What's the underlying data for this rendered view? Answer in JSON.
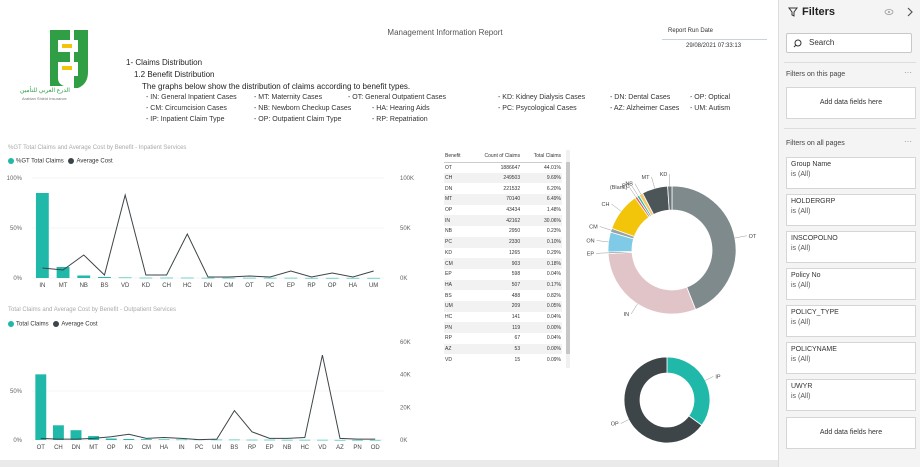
{
  "report": {
    "title": "Management Information Report",
    "run_date_label": "Report Run Date",
    "run_date_value": "29/08/2021 07:33:13",
    "logo_text_ar": "الدرع العربي للتأمين",
    "logo_text_en": "Arabian Shield Insurance"
  },
  "intro": {
    "section": "1- Claims Distribution",
    "subsection": "1.2 Benefit Distribution",
    "description": "The graphs below show the distribution of claims according to benefit types.",
    "legend": [
      "- IN: General Inpatient Cases",
      "- MT: Maternity Cases",
      "- OT: General Outpatient Cases",
      "- KD: Kidney Dialysis Cases",
      "- DN: Dental Cases",
      "- OP: Optical",
      "- CM: Circumcision Cases",
      "- NB: Newborn Checkup Cases",
      "- HA: Hearing Aids",
      "- PC: Psycological Cases",
      "- AZ: Alzheimer Cases",
      "- UM: Autism",
      "- IP: Inpatient Claim Type",
      "- OP: Outpatient Claim Type",
      "- RP: Repatriation"
    ]
  },
  "colors": {
    "teal": "#1fb8a9",
    "dark": "#3d4549",
    "grey": "#7f8a8c",
    "pink": "#e1c4c7",
    "yellow": "#f2c50a",
    "lightblue": "#7fcae6"
  },
  "chart_data": [
    {
      "type": "bar+line",
      "title": "%GT Total Claims and Average Cost by Benefit - Inpatient Services",
      "series_legend": [
        "%GT Total Claims",
        "Average Cost"
      ],
      "categories": [
        "IN",
        "MT",
        "NB",
        "BS",
        "VD",
        "KD",
        "CH",
        "HC",
        "DN",
        "CM",
        "OT",
        "PC",
        "EP",
        "RP",
        "OP",
        "HA",
        "UM"
      ],
      "series": [
        {
          "name": "%GT Total Claims",
          "values": [
            85,
            11,
            2.5,
            1,
            0.5,
            0.3,
            0.3,
            0.3,
            0.2,
            0.2,
            0.2,
            0.2,
            0.2,
            0.1,
            0.1,
            0.1,
            0.1
          ]
        },
        {
          "name": "Average Cost",
          "values": [
            10000,
            8000,
            23000,
            3000,
            83000,
            3000,
            3000,
            44000,
            1000,
            1000,
            2000,
            1000,
            7000,
            1000,
            5000,
            1000,
            7000
          ]
        }
      ],
      "left_axis_ticks": [
        "100%",
        "50%",
        "0%"
      ],
      "right_axis_ticks": [
        "100K",
        "50K",
        "0K"
      ],
      "ylim": [
        0,
        100
      ],
      "y2lim": [
        0,
        100000
      ]
    },
    {
      "type": "bar+line",
      "title": "Total Claims and Average Cost by Benefit - Outpatient Services",
      "series_legend": [
        "Total Claims",
        "Average Cost"
      ],
      "categories": [
        "OT",
        "CH",
        "DN",
        "MT",
        "OP",
        "KD",
        "CM",
        "HA",
        "IN",
        "PC",
        "UM",
        "BS",
        "RP",
        "EP",
        "NB",
        "HC",
        "VD",
        "AZ",
        "PN",
        "OD"
      ],
      "series": [
        {
          "name": "Total Claims",
          "values": [
            67,
            15,
            10,
            4,
            1.5,
            1,
            0.8,
            0.6,
            0.5,
            0.5,
            0.4,
            0.4,
            0.3,
            0.3,
            0.2,
            0.2,
            0.2,
            0.1,
            0.1,
            0.1
          ]
        },
        {
          "name": "Average Cost",
          "values": [
            1000,
            500,
            500,
            1000,
            2000,
            3500,
            1000,
            1500,
            1000,
            200,
            500,
            18000,
            5000,
            1000,
            1000,
            1500,
            52000,
            1000,
            500,
            500
          ]
        }
      ],
      "left_axis_ticks": [
        "50%",
        "0%"
      ],
      "right_axis_ticks": [
        "60K",
        "40K",
        "20K",
        "0K"
      ],
      "ylim": [
        0,
        100
      ],
      "y2lim": [
        0,
        60000
      ]
    },
    {
      "type": "table",
      "columns": [
        "Benefit",
        "Count of Claims",
        "Total Claims"
      ],
      "rows": [
        [
          "OT",
          "1886647",
          "44.01%"
        ],
        [
          "CH",
          "249503",
          "9.69%"
        ],
        [
          "DN",
          "221532",
          "6.20%"
        ],
        [
          "MT",
          "70140",
          "6.49%"
        ],
        [
          "OP",
          "43434",
          "1.48%"
        ],
        [
          "IN",
          "42162",
          "30.06%"
        ],
        [
          "NB",
          "2950",
          "0.23%"
        ],
        [
          "PC",
          "2330",
          "0.10%"
        ],
        [
          "KD",
          "1265",
          "0.29%"
        ],
        [
          "CM",
          "903",
          "0.18%"
        ],
        [
          "EP",
          "598",
          "0.04%"
        ],
        [
          "HA",
          "507",
          "0.17%"
        ],
        [
          "BS",
          "488",
          "0.82%"
        ],
        [
          "UM",
          "209",
          "0.05%"
        ],
        [
          "HC",
          "141",
          "0.04%"
        ],
        [
          "PN",
          "119",
          "0.00%"
        ],
        [
          "RP",
          "67",
          "0.04%"
        ],
        [
          "AZ",
          "53",
          "0.00%"
        ],
        [
          "VD",
          "15",
          "0.09%"
        ]
      ]
    },
    {
      "type": "pie",
      "donut": true,
      "labels": [
        "OT",
        "IN",
        "EP",
        "ON",
        "CM",
        "CH",
        "(Blank)",
        "PC",
        "NB",
        "MT",
        "KD"
      ],
      "slices": [
        {
          "label": "OT",
          "value": 44.0,
          "color": "#7f8a8c"
        },
        {
          "label": "IN",
          "value": 30.1,
          "color": "#e1c4c7"
        },
        {
          "label": "EP",
          "value": 0.4,
          "color": "#7f8a8c"
        },
        {
          "label": "ON",
          "value": 5.0,
          "color": "#7fcae6"
        },
        {
          "label": "CM",
          "value": 1.0,
          "color": "#9aa3a6"
        },
        {
          "label": "CH",
          "value": 9.7,
          "color": "#f2c50a"
        },
        {
          "label": "(Blank)",
          "value": 0.6,
          "color": "#e85a5a"
        },
        {
          "label": "PC",
          "value": 0.6,
          "color": "#1fb8a9"
        },
        {
          "label": "NB",
          "value": 1.0,
          "color": "#f5c76c"
        },
        {
          "label": "MT",
          "value": 6.5,
          "color": "#4c5558"
        },
        {
          "label": "KD",
          "value": 1.1,
          "color": "#6d7779"
        }
      ]
    },
    {
      "type": "pie",
      "donut": true,
      "slices": [
        {
          "label": "IP",
          "value": 35,
          "color": "#1fb8a9"
        },
        {
          "label": "OP",
          "value": 65,
          "color": "#3d4549"
        }
      ]
    }
  ],
  "filters": {
    "title": "Filters",
    "search_placeholder": "Search",
    "on_this_page": "Filters on this page",
    "on_all_pages": "Filters on all pages",
    "add_fields": "Add data fields here",
    "cards": [
      {
        "name": "Group Name",
        "value": "is (All)"
      },
      {
        "name": "HOLDERGRP",
        "value": "is (All)"
      },
      {
        "name": "INSCOPOLNO",
        "value": "is (All)"
      },
      {
        "name": "Policy No",
        "value": "is (All)"
      },
      {
        "name": "POLICY_TYPE",
        "value": "is (All)"
      },
      {
        "name": "POLICYNAME",
        "value": "is (All)"
      },
      {
        "name": "UWYR",
        "value": "is (All)"
      }
    ]
  }
}
